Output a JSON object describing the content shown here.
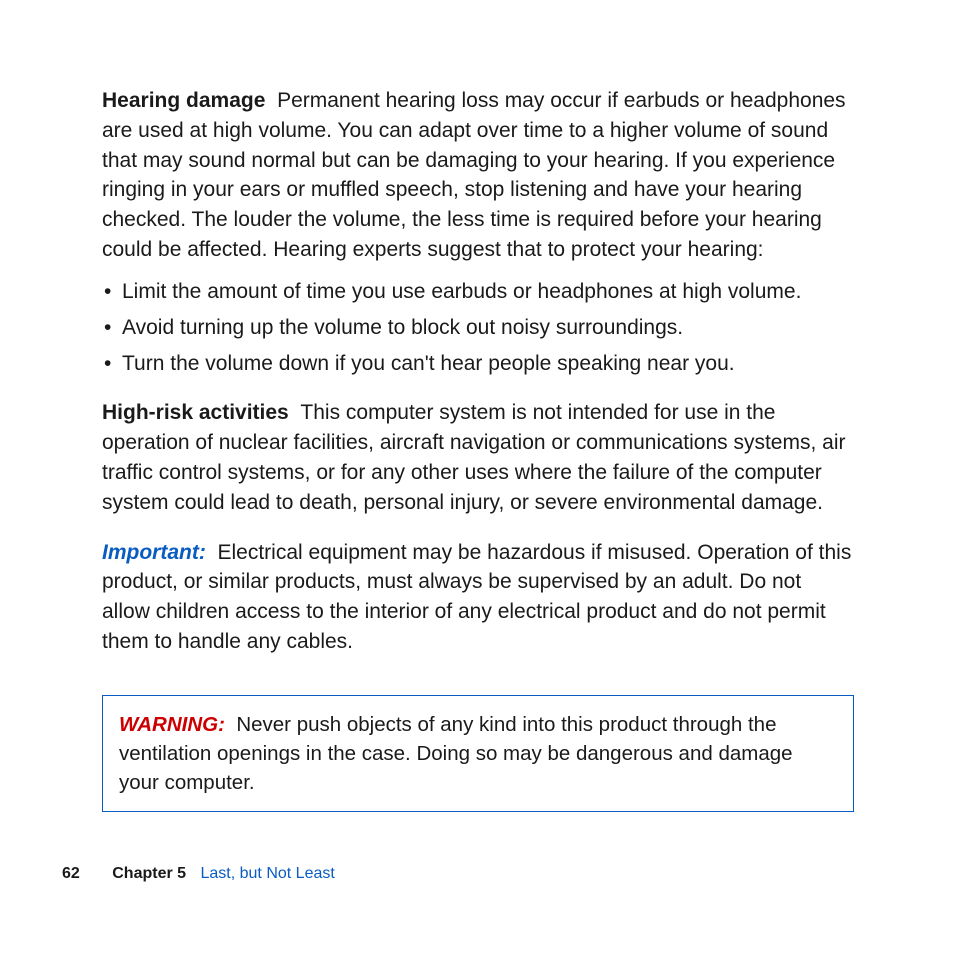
{
  "sections": {
    "hearingDamage": {
      "heading": "Hearing damage",
      "body": "Permanent hearing loss may occur if earbuds or headphones are used at high volume. You can adapt over time to a higher volume of sound that may sound normal but can be damaging to your hearing. If you experience ringing in your ears or muffled speech, stop listening and have your hearing checked. The louder the volume, the less time is required before your hearing could be affected. Hearing experts suggest that to protect your hearing:",
      "bullets": [
        "Limit the amount of time you use earbuds or headphones at high volume.",
        "Avoid turning up the volume to block out noisy surroundings.",
        "Turn the volume down if you can't hear people speaking near you."
      ]
    },
    "highRisk": {
      "heading": "High-risk activities",
      "body": "This computer system is not intended for use in the operation of nuclear facilities, aircraft navigation or communications systems, air traffic control systems, or for any other uses where the failure of the computer system could lead to death, personal injury, or severe environmental damage."
    },
    "important": {
      "label": "Important:",
      "body": "Electrical equipment may be hazardous if misused. Operation of this product, or similar products, must always be supervised by an adult. Do not allow children access to the interior of any electrical product and do not permit them to handle any cables."
    },
    "warning": {
      "label": "WARNING:",
      "body": "Never push objects of any kind into this product through the ventilation openings in the case. Doing so may be dangerous and damage your computer."
    }
  },
  "footer": {
    "pageNumber": "62",
    "chapterLabel": "Chapter 5",
    "chapterTitle": "Last, but Not Least"
  }
}
